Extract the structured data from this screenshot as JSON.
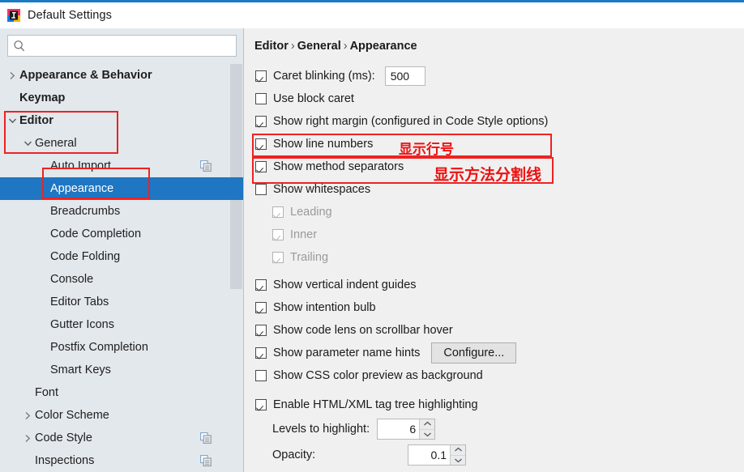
{
  "window": {
    "title": "Default Settings",
    "app_icon": "intellij-idea-icon",
    "accent_color": "#1b7ac4"
  },
  "sidebar": {
    "search": {
      "value": "",
      "placeholder": "",
      "icon": "search-icon"
    },
    "tree": [
      {
        "label": "Appearance & Behavior",
        "indent": 0,
        "arrow": "collapsed",
        "bold": true,
        "selected": false,
        "copy_icon": false
      },
      {
        "label": "Keymap",
        "indent": 0,
        "arrow": "none",
        "bold": true,
        "selected": false,
        "copy_icon": false
      },
      {
        "label": "Editor",
        "indent": 0,
        "arrow": "expanded",
        "bold": true,
        "selected": false,
        "copy_icon": false
      },
      {
        "label": "General",
        "indent": 1,
        "arrow": "expanded",
        "bold": false,
        "selected": false,
        "copy_icon": false
      },
      {
        "label": "Auto Import",
        "indent": 2,
        "arrow": "none",
        "bold": false,
        "selected": false,
        "copy_icon": true
      },
      {
        "label": "Appearance",
        "indent": 2,
        "arrow": "none",
        "bold": false,
        "selected": true,
        "copy_icon": false
      },
      {
        "label": "Breadcrumbs",
        "indent": 2,
        "arrow": "none",
        "bold": false,
        "selected": false,
        "copy_icon": false
      },
      {
        "label": "Code Completion",
        "indent": 2,
        "arrow": "none",
        "bold": false,
        "selected": false,
        "copy_icon": false
      },
      {
        "label": "Code Folding",
        "indent": 2,
        "arrow": "none",
        "bold": false,
        "selected": false,
        "copy_icon": false
      },
      {
        "label": "Console",
        "indent": 2,
        "arrow": "none",
        "bold": false,
        "selected": false,
        "copy_icon": false
      },
      {
        "label": "Editor Tabs",
        "indent": 2,
        "arrow": "none",
        "bold": false,
        "selected": false,
        "copy_icon": false
      },
      {
        "label": "Gutter Icons",
        "indent": 2,
        "arrow": "none",
        "bold": false,
        "selected": false,
        "copy_icon": false
      },
      {
        "label": "Postfix Completion",
        "indent": 2,
        "arrow": "none",
        "bold": false,
        "selected": false,
        "copy_icon": false
      },
      {
        "label": "Smart Keys",
        "indent": 2,
        "arrow": "none",
        "bold": false,
        "selected": false,
        "copy_icon": false
      },
      {
        "label": "Font",
        "indent": 1,
        "arrow": "none",
        "bold": false,
        "selected": false,
        "copy_icon": false
      },
      {
        "label": "Color Scheme",
        "indent": 1,
        "arrow": "collapsed",
        "bold": false,
        "selected": false,
        "copy_icon": false
      },
      {
        "label": "Code Style",
        "indent": 1,
        "arrow": "collapsed",
        "bold": false,
        "selected": false,
        "copy_icon": true
      },
      {
        "label": "Inspections",
        "indent": 1,
        "arrow": "none",
        "bold": false,
        "selected": false,
        "copy_icon": true
      }
    ]
  },
  "panel": {
    "breadcrumb": {
      "parts": [
        "Editor",
        "General",
        "Appearance"
      ],
      "separator": "›"
    },
    "options": [
      {
        "label": "Caret blinking (ms):",
        "checked": true,
        "enabled": true,
        "indent": 0,
        "control": "textfield",
        "value": "500"
      },
      {
        "label": "Use block caret",
        "checked": false,
        "enabled": true,
        "indent": 0,
        "control": "none"
      },
      {
        "label": "Show right margin (configured in Code Style options)",
        "checked": true,
        "enabled": true,
        "indent": 0,
        "control": "none"
      },
      {
        "label": "Show line numbers",
        "checked": true,
        "enabled": true,
        "indent": 0,
        "control": "none"
      },
      {
        "label": "Show method separators",
        "checked": true,
        "enabled": true,
        "indent": 0,
        "control": "none"
      },
      {
        "label": "Show whitespaces",
        "checked": false,
        "enabled": true,
        "indent": 0,
        "control": "none"
      },
      {
        "label": "Leading",
        "checked": true,
        "enabled": false,
        "indent": 1,
        "control": "none"
      },
      {
        "label": "Inner",
        "checked": true,
        "enabled": false,
        "indent": 1,
        "control": "none"
      },
      {
        "label": "Trailing",
        "checked": true,
        "enabled": false,
        "indent": 1,
        "control": "none"
      },
      {
        "label": "Show vertical indent guides",
        "checked": true,
        "enabled": true,
        "indent": 0,
        "control": "none"
      },
      {
        "label": "Show intention bulb",
        "checked": true,
        "enabled": true,
        "indent": 0,
        "control": "none"
      },
      {
        "label": "Show code lens on scrollbar hover",
        "checked": true,
        "enabled": true,
        "indent": 0,
        "control": "none"
      },
      {
        "label": "Show parameter name hints",
        "checked": true,
        "enabled": true,
        "indent": 0,
        "control": "button",
        "button_label": "Configure..."
      },
      {
        "label": "Show CSS color preview as background",
        "checked": false,
        "enabled": true,
        "indent": 0,
        "control": "none"
      }
    ],
    "html_section": {
      "enable_label": "Enable HTML/XML tag tree highlighting",
      "enable_checked": true,
      "levels_label": "Levels to highlight:",
      "levels_value": "6",
      "opacity_label": "Opacity:",
      "opacity_value": "0.1"
    }
  },
  "annotations": {
    "color": "#ee1111",
    "notes": [
      {
        "text": "显示行号",
        "name": "annotation-show-line-numbers"
      },
      {
        "text": "显示方法分割线",
        "name": "annotation-show-method-separators"
      }
    ],
    "boxes": [
      {
        "name": "redbox-editor-general"
      },
      {
        "name": "redbox-appearance"
      },
      {
        "name": "redbox-show-line-numbers"
      },
      {
        "name": "redbox-show-method-separators"
      }
    ]
  }
}
